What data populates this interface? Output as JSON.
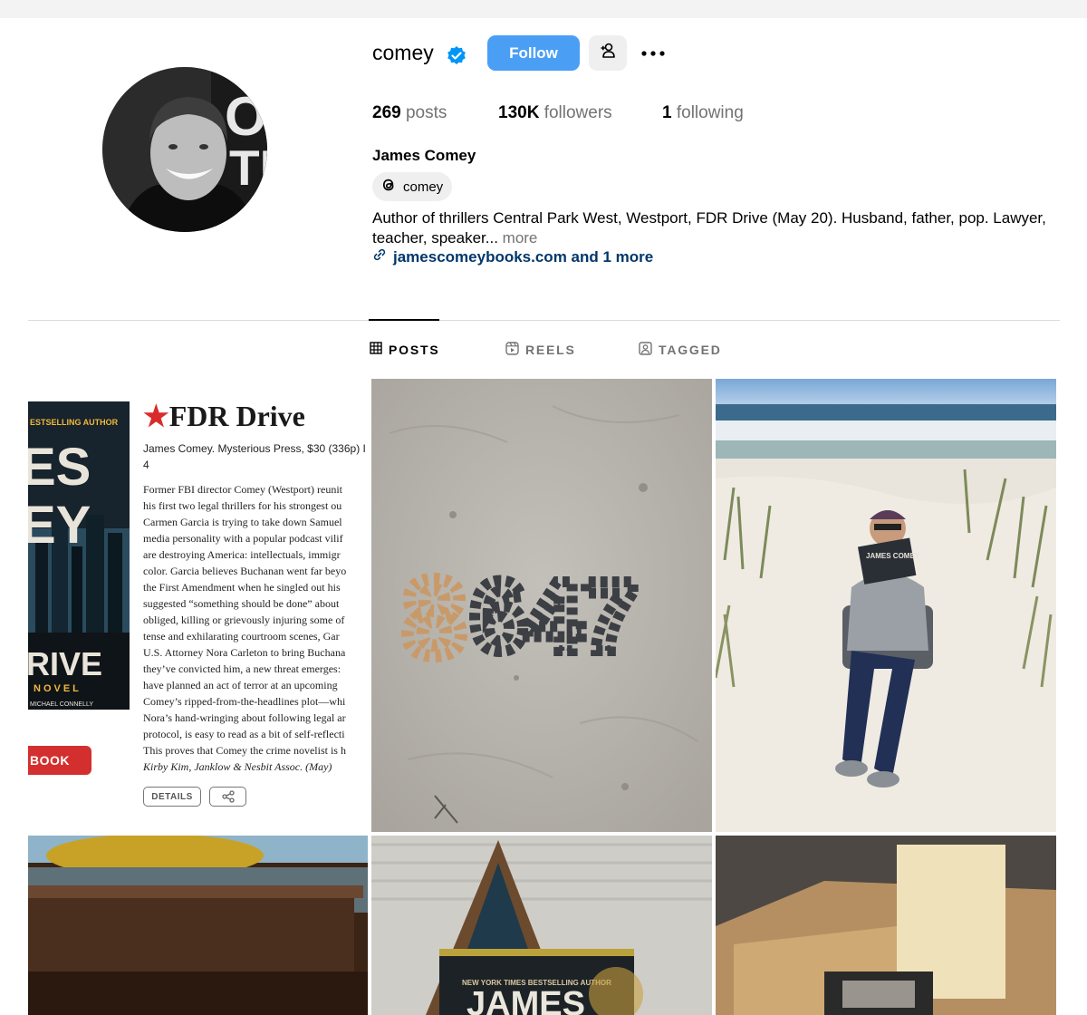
{
  "profile": {
    "username": "comey",
    "follow_label": "Follow",
    "full_name": "James Comey",
    "threads_handle": "comey",
    "bio_text": "Author of thrillers Central Park West, Westport, FDR Drive (May 20). Husband, father, pop. Lawyer, teacher, speaker...",
    "bio_more": "more",
    "link_text": "jamescomeybooks.com and 1 more",
    "stats": {
      "posts_count": "269",
      "posts_label": "posts",
      "followers_count": "130K",
      "followers_label": "followers",
      "following_count": "1",
      "following_label": "following"
    }
  },
  "tabs": [
    {
      "label": "POSTS",
      "active": true
    },
    {
      "label": "REELS",
      "active": false
    },
    {
      "label": "TAGGED",
      "active": false
    }
  ],
  "posts": {
    "review": {
      "cover_top": "ESTSELLING AUTHOR",
      "cover_line1": "ES",
      "cover_line2": "EY",
      "cover_line3": "RIVE",
      "cover_line4": "NOVEL",
      "cover_line5": "MICHAEL CONNELLY",
      "star": "★",
      "headline": "FDR Drive",
      "meta_line": "James Comey. Mysterious Press, $30 (336p) I",
      "meta_line2": "4",
      "body_text": "Former FBI director Comey (Westport) reunit\nhis first two legal thrillers for his strongest ou\nCarmen Garcia is trying to take down Samuel\nmedia personality with a popular podcast vilif\nare destroying America: intellectuals, immigr\ncolor. Garcia believes Buchanan went far beyo\nthe First Amendment when he singled out his\nsuggested “something should be done” about\nobliged, killing or grievously injuring some of\ntense and exhilarating courtroom scenes, Gar\nU.S. Attorney Nora Carleton to bring Buchana\nthey’ve convicted him, a new threat emerges:\nhave planned an act of terror at an upcoming\nComey’s ripped-from-the-headlines plot—whi\nNora’s hand-wringing about following legal ar\nprotocol, is easy to read as a bit of self-reflecti\nThis proves that Comey the crime novelist is h",
      "agent_line": "Kirby Kim, Janklow & Nesbit Assoc. (May)",
      "book_button": "BOOK",
      "details_button": "DETAILS"
    },
    "book_cover_text": "NEW YORK TIMES BESTSELLING AUTHOR",
    "book_cover_name": "JAMES",
    "sand_numbers": "8647",
    "reader_book": "JAMES COMEY"
  },
  "colors": {
    "follow_blue": "#4a9ff5",
    "link_blue": "#00376b",
    "muted_grey": "#737373",
    "review_red": "#d32f2f"
  },
  "icons": [
    "verified-badge-icon",
    "add-person-icon",
    "more-options-icon",
    "threads-icon",
    "link-icon",
    "grid-icon",
    "reels-icon",
    "tagged-icon",
    "share-icon"
  ]
}
